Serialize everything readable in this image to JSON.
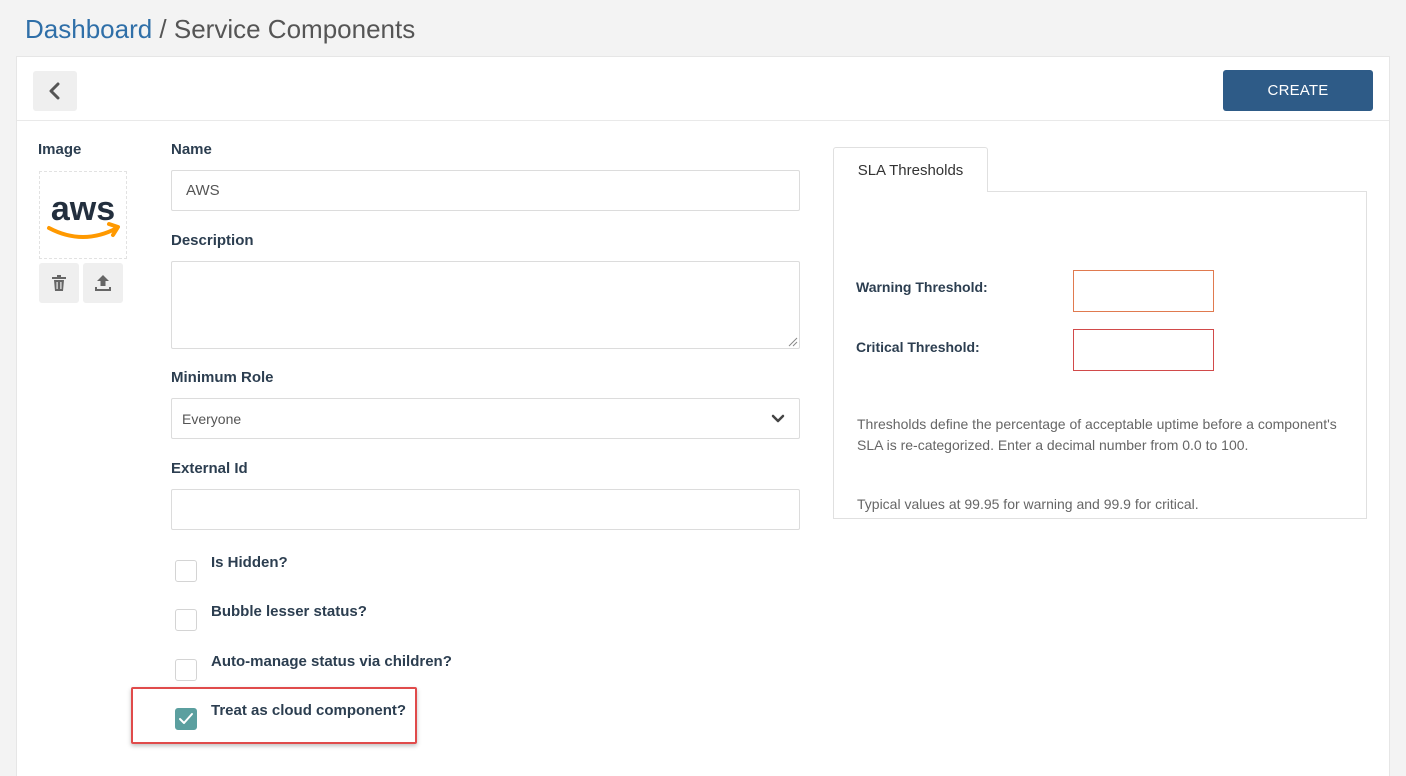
{
  "breadcrumb": {
    "root": "Dashboard",
    "separator": " / ",
    "current": "Service Components"
  },
  "toolbar": {
    "back_icon": "chevron-left-icon",
    "create_label": "CREATE"
  },
  "image": {
    "label": "Image",
    "logo_text": "aws",
    "delete_icon": "trash-icon",
    "upload_icon": "upload-icon"
  },
  "form": {
    "name": {
      "label": "Name",
      "value": "AWS"
    },
    "description": {
      "label": "Description",
      "value": ""
    },
    "minimum_role": {
      "label": "Minimum Role",
      "value": "Everyone"
    },
    "external_id": {
      "label": "External Id",
      "value": ""
    },
    "checkboxes": [
      {
        "label": "Is Hidden?",
        "checked": false
      },
      {
        "label": "Bubble lesser status?",
        "checked": false
      },
      {
        "label": "Auto-manage status via children?",
        "checked": false
      },
      {
        "label": "Treat as cloud component?",
        "checked": true
      }
    ]
  },
  "sla": {
    "tab_label": "SLA Thresholds",
    "warning": {
      "label": "Warning Threshold:",
      "value": ""
    },
    "critical": {
      "label": "Critical Threshold:",
      "value": ""
    },
    "help_1": "Thresholds define the percentage of acceptable uptime before a component's SLA is re-categorized. Enter a decimal number from 0.0 to 100.",
    "help_2": "Typical values at 99.95 for warning and 99.9 for critical."
  },
  "colors": {
    "link": "#2f6fa8",
    "primary_button": "#2e5b87",
    "checkbox_checked": "#5b9f9f",
    "highlight": "#e04b4b",
    "warning_border": "#e07a4f",
    "critical_border": "#d14a4a",
    "aws_smile": "#f90"
  }
}
